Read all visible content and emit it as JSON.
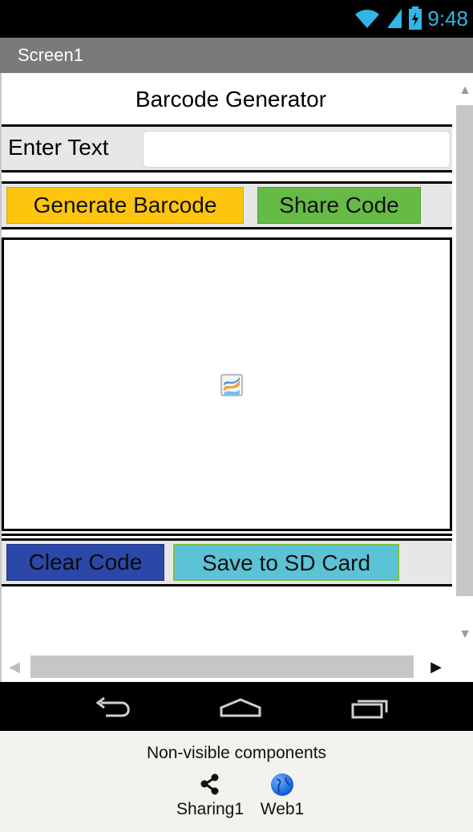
{
  "status_bar": {
    "time": "9:48",
    "icons": [
      "wifi-icon",
      "signal-icon",
      "battery-icon"
    ]
  },
  "screen": {
    "title": "Screen1"
  },
  "app": {
    "title": "Barcode Generator",
    "input_label": "Enter Text",
    "input_value": "",
    "buttons": {
      "generate": "Generate Barcode",
      "share": "Share Code",
      "clear": "Clear Code",
      "save": "Save to SD Card"
    },
    "image_placeholder_icon": "broken-image-icon"
  },
  "nav_bar": {
    "icons": [
      "back-icon",
      "home-icon",
      "recent-apps-icon"
    ]
  },
  "non_visible": {
    "title": "Non-visible components",
    "items": [
      {
        "label": "Sharing1",
        "icon": "share-icon"
      },
      {
        "label": "Web1",
        "icon": "globe-icon"
      }
    ]
  },
  "colors": {
    "generate": "#fec50e",
    "share": "#66bb46",
    "clear": "#2b47a8",
    "save": "#5cc3d6",
    "clock": "#33b5e5"
  }
}
